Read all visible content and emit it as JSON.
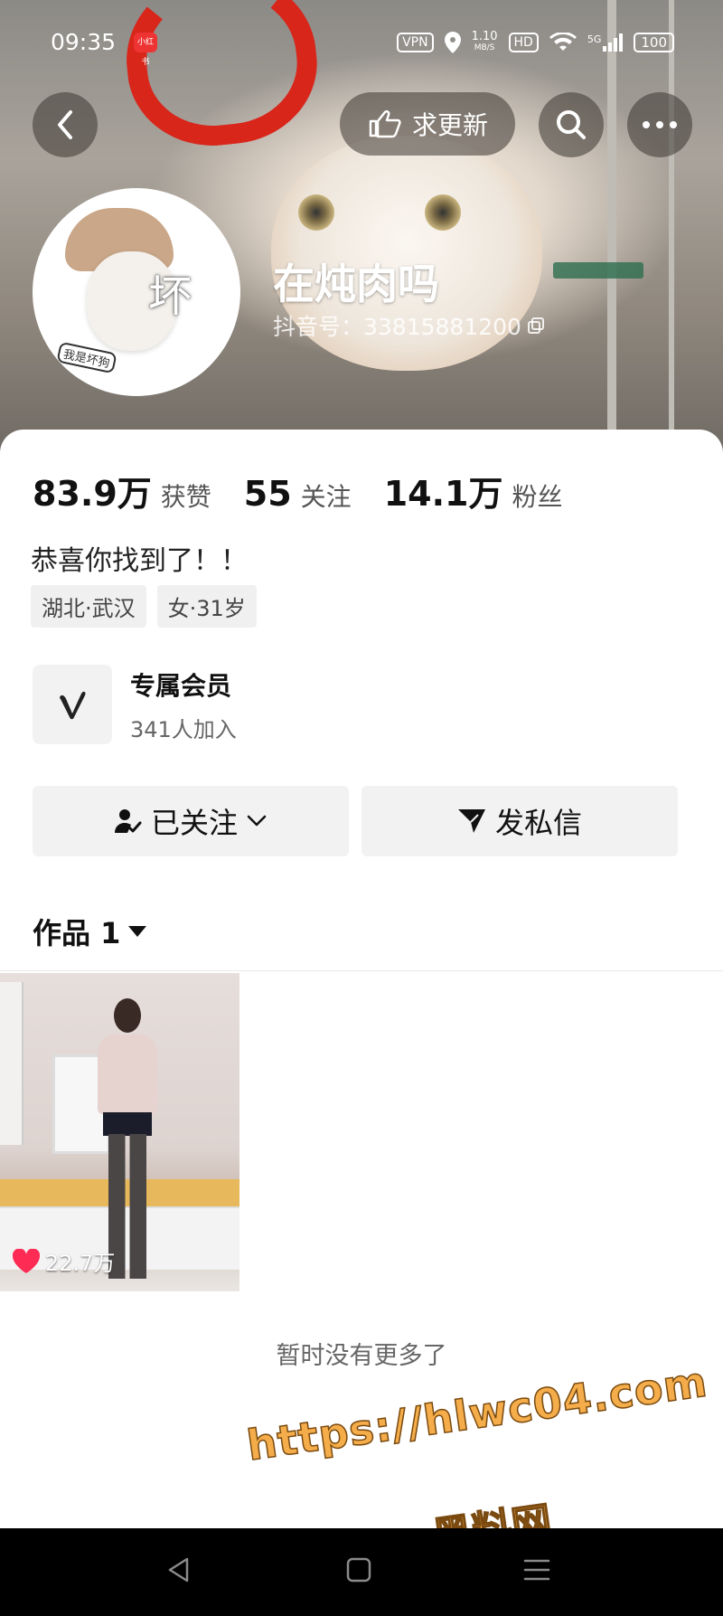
{
  "status_bar": {
    "time": "09:35",
    "app_badge": "小红书",
    "vpn": "VPN",
    "net_speed_top": "1.10",
    "net_speed_unit": "MB/S",
    "hd": "HD",
    "signal": "5G",
    "battery": "100"
  },
  "header": {
    "update_label": "求更新"
  },
  "profile": {
    "nickname": "在炖肉吗",
    "douyin_id": "抖音号：33815881200",
    "avatar_text": "坏",
    "avatar_sticker": "我是坏狗"
  },
  "stats": {
    "likes_value": "83.9万",
    "likes_label": "获赞",
    "following_value": "55",
    "following_label": "关注",
    "followers_value": "14.1万",
    "followers_label": "粉丝"
  },
  "bio": "恭喜你找到了！！",
  "tags": [
    "湖北·武汉",
    "女·31岁"
  ],
  "membership": {
    "title": "专属会员",
    "subtitle": "341人加入"
  },
  "actions": {
    "follow_label": "已关注",
    "message_label": "发私信"
  },
  "works": {
    "tab_label": "作品 1",
    "videos": [
      {
        "likes": "22.7万"
      }
    ],
    "no_more": "暂时没有更多了"
  },
  "watermark": {
    "url": "https://hlwc04.com",
    "name": "黑料网"
  },
  "colors": {
    "like_red": "#fe2c55",
    "watermark_orange": "#f4ad4a"
  }
}
